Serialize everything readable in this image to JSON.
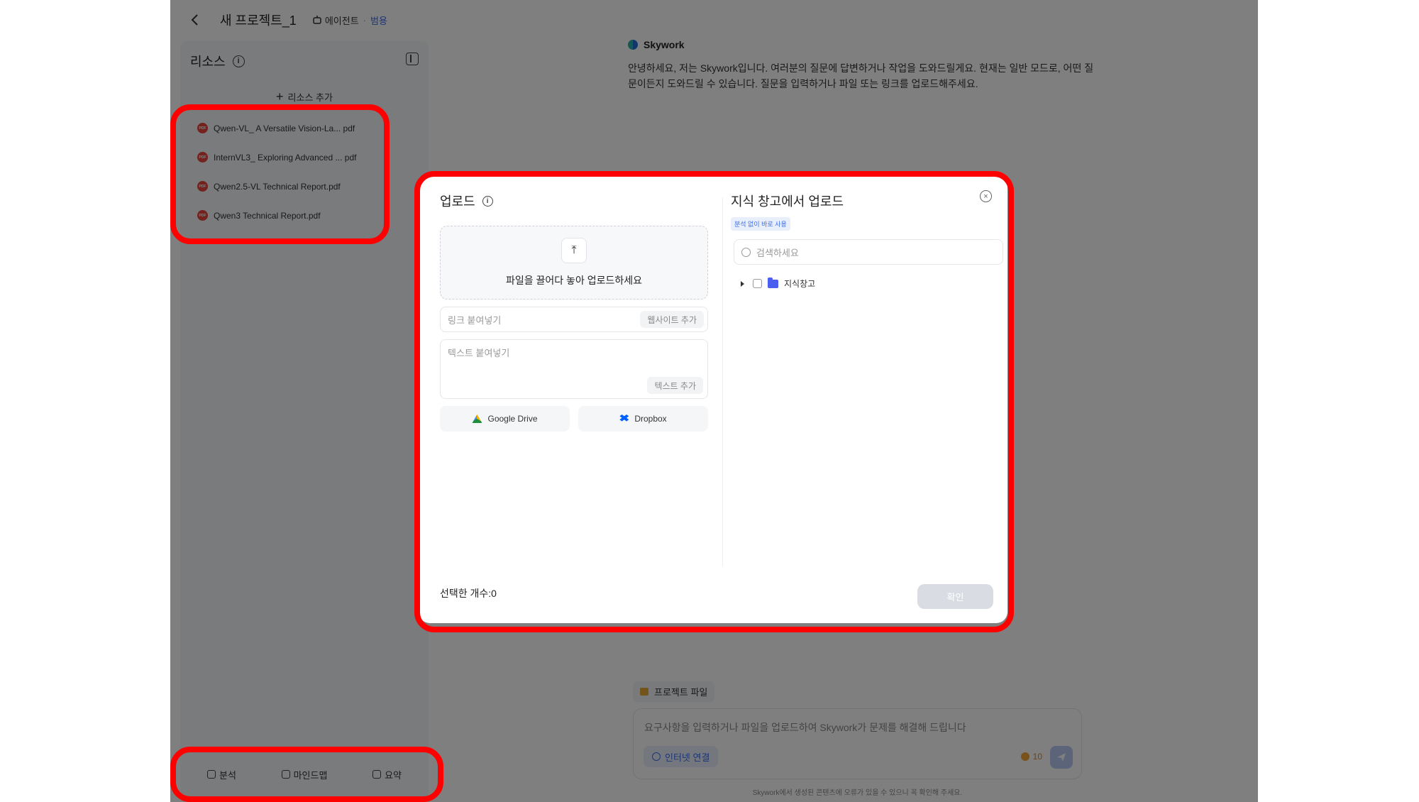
{
  "topbar": {
    "project_title": "새 프로젝트_1",
    "agent_label": "에이전트",
    "agent_mode": "범용"
  },
  "resources": {
    "title": "리소스",
    "add_label": "리소스 추가",
    "items": [
      {
        "name": "Qwen-VL_ A Versatile Vision-La... pdf"
      },
      {
        "name": "InternVL3_ Exploring Advanced ... pdf"
      },
      {
        "name": "Qwen2.5-VL Technical Report.pdf"
      },
      {
        "name": "Qwen3 Technical Report.pdf"
      }
    ],
    "pdf_badge": "PDF",
    "footer": {
      "analyze": "분석",
      "mindmap": "마인드맵",
      "summary": "요약"
    }
  },
  "chat": {
    "brand": "Skywork",
    "greeting": "안녕하세요, 저는 Skywork입니다. 여러분의 질문에 답변하거나 작업을 도와드릴게요. 현재는 일반 모드로, 어떤 질문이든지 도와드릴 수 있습니다. 질문을 입력하거나 파일 또는 링크를 업로드해주세요.",
    "project_files": "프로젝트 파일",
    "input_placeholder": "요구사항을 입력하거나 파일을 업로드하여 Skywork가 문제를 해결해 드립니다",
    "internet_button": "인터넷 연결",
    "credit": "10",
    "disclaimer": "Skywork에서 생성된 콘텐츠에 오류가 있을 수 있으니 꼭 확인해 주세요."
  },
  "modal": {
    "upload_title": "업로드",
    "dropzone_label": "파일을 끌어다 놓아 업로드하세요",
    "link_placeholder": "링크 붙여넣기",
    "add_website": "웹사이트 추가",
    "text_placeholder": "텍스트 붙여넣기",
    "add_text": "텍스트 추가",
    "google_drive": "Google Drive",
    "dropbox": "Dropbox",
    "kb_title": "지식 창고에서 업로드",
    "kb_badge": "분석 없이 바로 사용",
    "kb_search_placeholder": "검색하세요",
    "kb_folder": "지식창고",
    "selected_count": "선택한 개수:0",
    "confirm": "확인"
  },
  "colors": {
    "highlight": "#ff0000",
    "accent": "#3b6ee8",
    "overlay": "rgba(0,0,0,0.5)"
  }
}
